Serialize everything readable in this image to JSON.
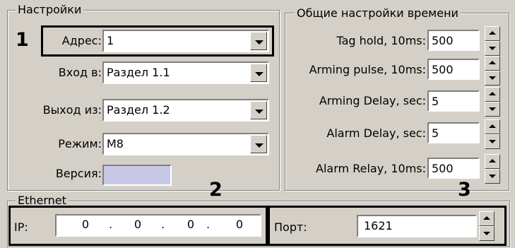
{
  "settings": {
    "title": "Настройки",
    "address": {
      "label": "Адрес:",
      "value": "1"
    },
    "input": {
      "label": "Вход в:",
      "value": "Раздел 1.1"
    },
    "output": {
      "label": "Выход из:",
      "value": "Раздел 1.2"
    },
    "mode": {
      "label": "Режим:",
      "value": "M8"
    },
    "version": {
      "label": "Версия:",
      "value": ""
    }
  },
  "time": {
    "title": "Общие настройки времени",
    "tag_hold": {
      "label": "Tag hold, 10ms:",
      "value": "500"
    },
    "arming_pulse": {
      "label": "Arming pulse, 10ms:",
      "value": "500"
    },
    "arming_delay": {
      "label": "Arming Delay, sec:",
      "value": "5"
    },
    "alarm_delay": {
      "label": "Alarm Delay, sec:",
      "value": "5"
    },
    "alarm_relay": {
      "label": "Alarm Relay, 10ms:",
      "value": "500"
    }
  },
  "ethernet": {
    "title": "Ethernet",
    "ip": {
      "label": "IP:",
      "octets": [
        "0",
        "0",
        "0",
        "0"
      ],
      "dot": "."
    },
    "port": {
      "label": "Порт:",
      "value": "1621"
    }
  },
  "callouts": {
    "one": "1",
    "two": "2",
    "three": "3"
  }
}
